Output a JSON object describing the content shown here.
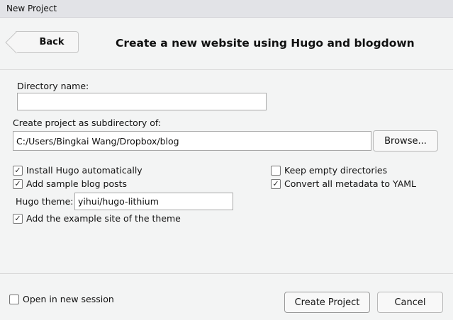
{
  "window": {
    "title": "New Project"
  },
  "header": {
    "back_label": "Back",
    "title": "Create a new website using Hugo and blogdown"
  },
  "form": {
    "directory_name_label": "Directory name:",
    "directory_name_value": "",
    "parent_dir_label": "Create project as subdirectory of:",
    "parent_dir_value": "C:/Users/Bingkai Wang/Dropbox/blog",
    "browse_label": "Browse...",
    "install_hugo": {
      "label": "Install Hugo automatically",
      "checked": true
    },
    "sample_posts": {
      "label": "Add sample blog posts",
      "checked": true
    },
    "keep_empty": {
      "label": "Keep empty directories",
      "checked": false
    },
    "convert_yaml": {
      "label": "Convert all metadata to YAML",
      "checked": true
    },
    "theme_label": "Hugo theme:",
    "theme_value": "yihui/hugo-lithium",
    "example_site": {
      "label": "Add the example site of the theme",
      "checked": true
    }
  },
  "footer": {
    "new_session": {
      "label": "Open in new session",
      "checked": false
    },
    "create_label": "Create Project",
    "cancel_label": "Cancel"
  }
}
